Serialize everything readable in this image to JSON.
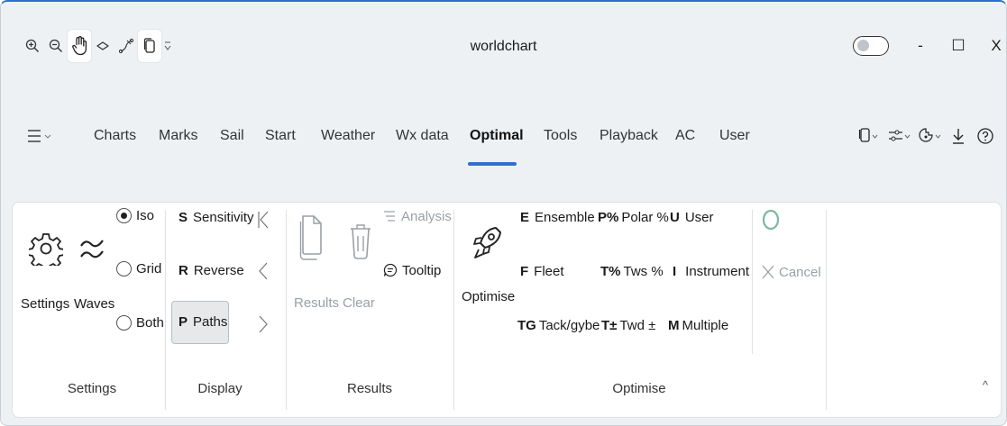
{
  "window": {
    "title": "worldchart",
    "controls": {
      "minimize": "-",
      "maximize": "☐",
      "close": "X"
    },
    "quick_access": [
      "zoom-in",
      "zoom-out",
      "hand-pan",
      "lasso",
      "measure",
      "copy",
      "more"
    ]
  },
  "tabs": [
    {
      "label": "Charts"
    },
    {
      "label": "Marks"
    },
    {
      "label": "Sail"
    },
    {
      "label": "Start"
    },
    {
      "label": "Weather"
    },
    {
      "label": "Wx data"
    },
    {
      "label": "Optimal",
      "active": true
    },
    {
      "label": "Tools"
    },
    {
      "label": "Playback"
    },
    {
      "label": "AC"
    },
    {
      "label": "User"
    }
  ],
  "ribbon": {
    "settings_group": {
      "label": "Settings",
      "settings_label": "Settings",
      "waves_label": "Waves",
      "radios": [
        {
          "label": "Iso",
          "checked": true
        },
        {
          "label": "Grid",
          "checked": false
        },
        {
          "label": "Both",
          "checked": false
        }
      ]
    },
    "display_group": {
      "label": "Display",
      "items": [
        {
          "key": "S",
          "label": "Sensitivity"
        },
        {
          "key": "R",
          "label": "Reverse"
        },
        {
          "key": "P",
          "label": "Paths"
        }
      ]
    },
    "results_group": {
      "label": "Results",
      "results_label": "Results",
      "clear_label": "Clear",
      "analysis_label": "Analysis",
      "tooltip_label": "Tooltip"
    },
    "optimise_group": {
      "label": "Optimise",
      "optimise_label": "Optimise",
      "col1": [
        {
          "key": "E",
          "label": "Ensemble"
        },
        {
          "key": "F",
          "label": "Fleet"
        },
        {
          "key": "TG",
          "label": "Tack/gybe"
        }
      ],
      "col2": [
        {
          "key": "P%",
          "label": "Polar %"
        },
        {
          "key": "T%",
          "label": "Tws %"
        },
        {
          "key": "T±",
          "label": "Twd ±"
        }
      ],
      "col3": [
        {
          "key": "U",
          "label": "User"
        },
        {
          "key": "I",
          "label": "Instrument"
        },
        {
          "key": "M",
          "label": "Multiple"
        }
      ],
      "cancel_label": "Cancel"
    }
  },
  "colors": {
    "accent": "#2f6fcf",
    "disabled": "#9aa0a6",
    "spinner": "#7fb8a0"
  }
}
